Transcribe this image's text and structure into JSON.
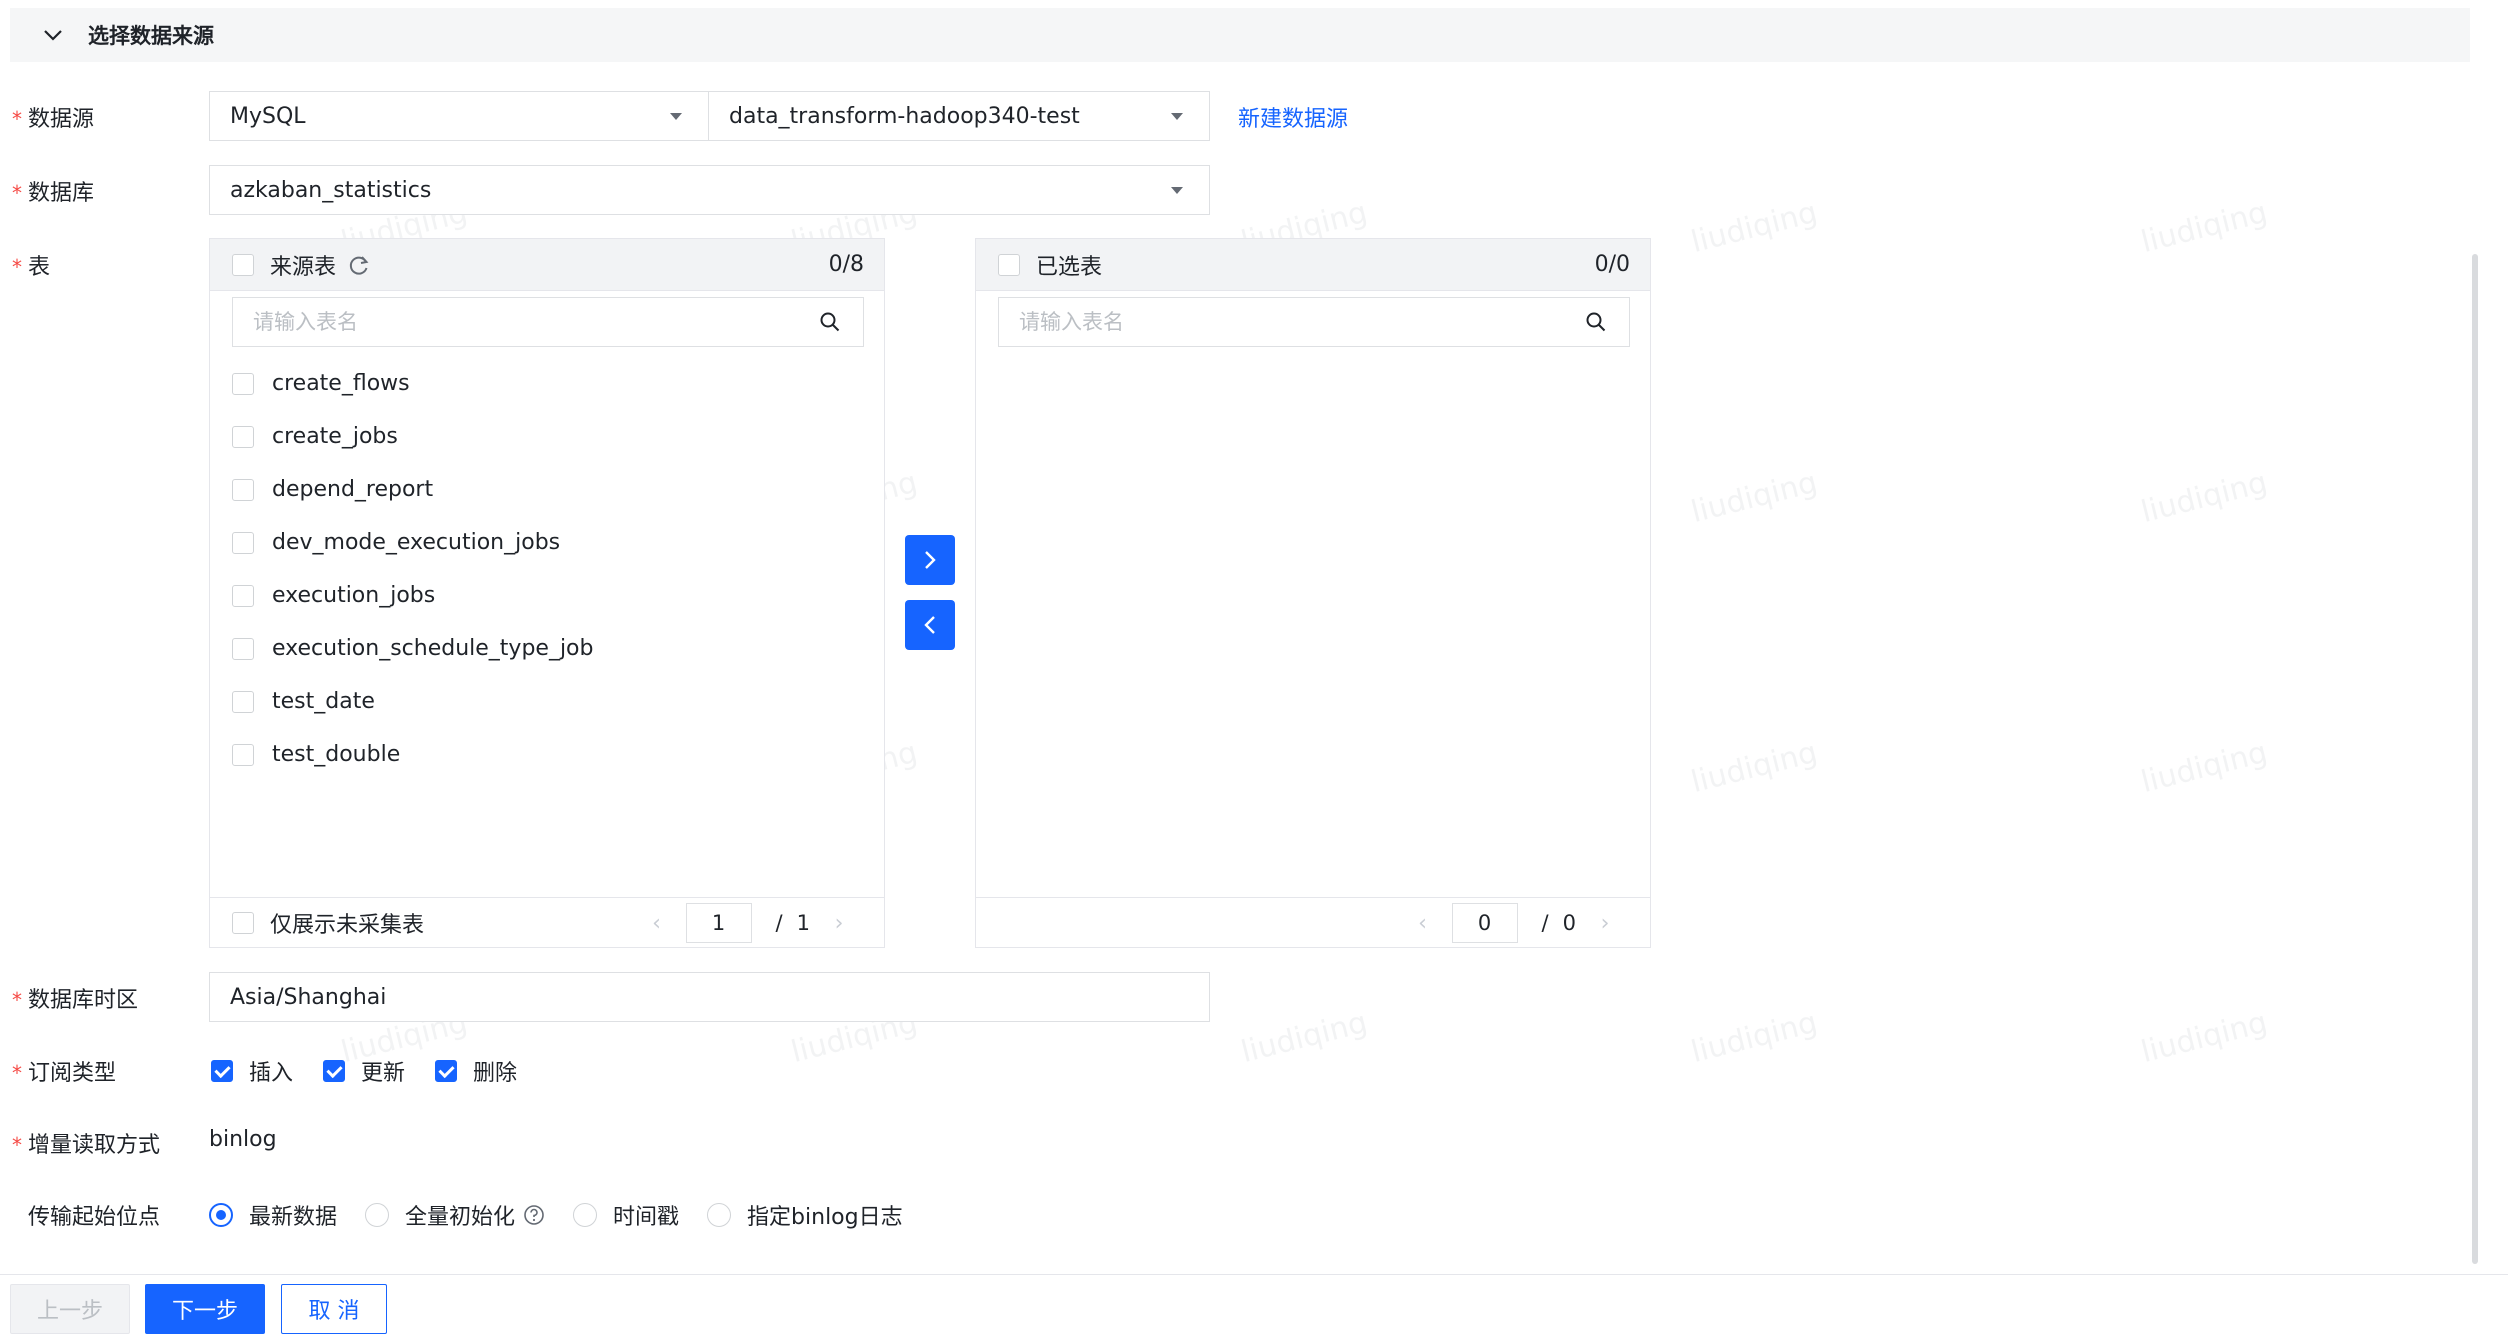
{
  "section": {
    "title": "选择数据来源"
  },
  "fields": {
    "datasource": {
      "label": "数据源",
      "type_value": "MySQL",
      "instance_value": "data_transform-hadoop340-test",
      "new_link": "新建数据源"
    },
    "database": {
      "label": "数据库",
      "value": "azkaban_statistics"
    },
    "table": {
      "label": "表"
    },
    "timezone": {
      "label": "数据库时区",
      "value": "Asia/Shanghai"
    },
    "subscribe": {
      "label": "订阅类型",
      "options": [
        {
          "label": "插入",
          "checked": true
        },
        {
          "label": "更新",
          "checked": true
        },
        {
          "label": "删除",
          "checked": true
        }
      ]
    },
    "incremental": {
      "label": "增量读取方式",
      "value": "binlog"
    },
    "start_point": {
      "label": "传输起始位点",
      "options": [
        {
          "label": "最新数据",
          "selected": true
        },
        {
          "label": "全量初始化",
          "selected": false,
          "help": true
        },
        {
          "label": "时间戳",
          "selected": false
        },
        {
          "label": "指定binlog日志",
          "selected": false
        }
      ]
    }
  },
  "transfer": {
    "source": {
      "title": "来源表",
      "count": "0/8",
      "search_placeholder": "请输入表名",
      "items": [
        "create_flows",
        "create_jobs",
        "depend_report",
        "dev_mode_execution_jobs",
        "execution_jobs",
        "execution_schedule_type_job",
        "test_date",
        "test_double"
      ],
      "footer_label": "仅展示未采集表",
      "page_current": "1",
      "page_slash": "/",
      "page_total": "1"
    },
    "target": {
      "title": "已选表",
      "count": "0/0",
      "search_placeholder": "请输入表名",
      "page_current": "0",
      "page_slash": "/",
      "page_total": "0"
    }
  },
  "buttons": {
    "prev": "上一步",
    "next": "下一步",
    "cancel": "取 消"
  },
  "watermark": "liudiqing",
  "colors": {
    "primary": "#1664ff",
    "required": "#f54a45",
    "border": "#dee0e3"
  }
}
